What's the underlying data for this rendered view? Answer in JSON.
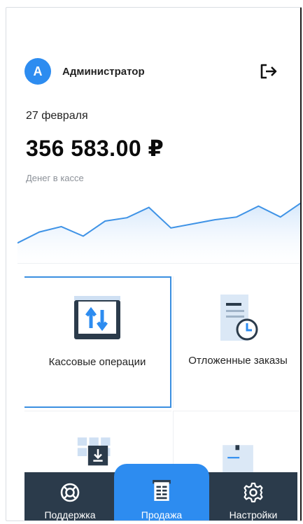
{
  "user": {
    "avatar_letter": "A",
    "name": "Администратор"
  },
  "summary": {
    "date": "27 февраля",
    "amount": "356 583.00 ₽",
    "amount_label": "Денег в кассе"
  },
  "chart_data": {
    "type": "area",
    "x": [
      0,
      1,
      2,
      3,
      4,
      5,
      6,
      7,
      8,
      9,
      10,
      11,
      12,
      13
    ],
    "values": [
      10,
      26,
      34,
      20,
      42,
      47,
      62,
      32,
      38,
      44,
      48,
      64,
      48,
      70
    ],
    "color": "#3f93e6"
  },
  "tiles": [
    {
      "label": "Кассовые операции",
      "icon": "cash-operations-icon",
      "selected": true
    },
    {
      "label": "Отложенные заказы",
      "icon": "deferred-orders-icon",
      "selected": false
    },
    {
      "label": "",
      "icon": "warehouse-receipt-icon",
      "selected": false
    },
    {
      "label": "",
      "icon": "box-icon",
      "selected": false
    }
  ],
  "nav": {
    "support_label": "Поддержка",
    "sale_label": "Продажа",
    "settings_label": "Настройки",
    "active": "Продажа"
  },
  "colors": {
    "accent": "#2d8cf0",
    "nav_bg": "#2b3b4b",
    "selected_border": "#3b8fe0"
  }
}
